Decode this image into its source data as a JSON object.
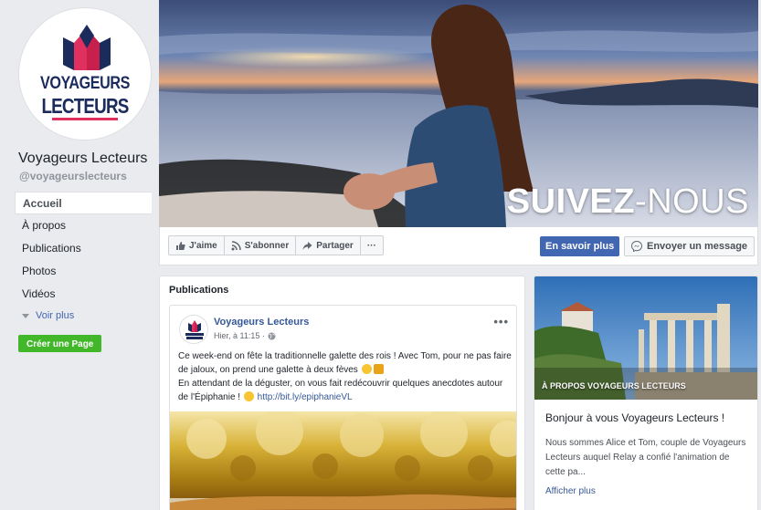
{
  "page": {
    "name": "Voyageurs Lecteurs",
    "handle": "@voyageurslecteurs",
    "logo_line1": "VOYAGEURS",
    "logo_line2": "LECTEURS"
  },
  "sidebar": {
    "items": [
      {
        "label": "Accueil",
        "active": true
      },
      {
        "label": "À propos"
      },
      {
        "label": "Publications"
      },
      {
        "label": "Photos"
      },
      {
        "label": "Vidéos"
      }
    ],
    "more_label": "Voir plus",
    "create_page_label": "Créer une Page"
  },
  "cover": {
    "overlay_bold": "SUIVEZ",
    "overlay_light": "-NOUS"
  },
  "actions": {
    "like_label": "J'aime",
    "follow_label": "S'abonner",
    "share_label": "Partager",
    "more_label": "···",
    "learn_more_label": "En savoir plus",
    "message_label": "Envoyer un message"
  },
  "publications": {
    "title": "Publications",
    "post": {
      "author": "Voyageurs Lecteurs",
      "time": "Hier, à 11:15 ·",
      "more": "•••",
      "text_line1": "Ce week-end on fête la traditionnelle galette des rois ! Avec Tom, pour ne pas faire de jaloux, on prend une galette à deux fèves",
      "text_line2": "En attendant de la déguster, on vous fait redécouvrir quelques anecdotes autour de l'Épiphanie !",
      "link": "http://bit.ly/epiphanieVL"
    }
  },
  "about": {
    "caption": "À PROPOS VOYAGEURS LECTEURS",
    "heading": "Bonjour à vous Voyageurs Lecteurs !",
    "text": "Nous sommes Alice et Tom, couple de Voyageurs Lecteurs auquel Relay a confié l'animation de cette pa...",
    "link": "Afficher plus"
  },
  "colors": {
    "fb_blue": "#4267b2",
    "link_blue": "#365899",
    "green": "#42b72a",
    "brand_navy": "#1a2b5c",
    "brand_pink": "#e0305f"
  }
}
